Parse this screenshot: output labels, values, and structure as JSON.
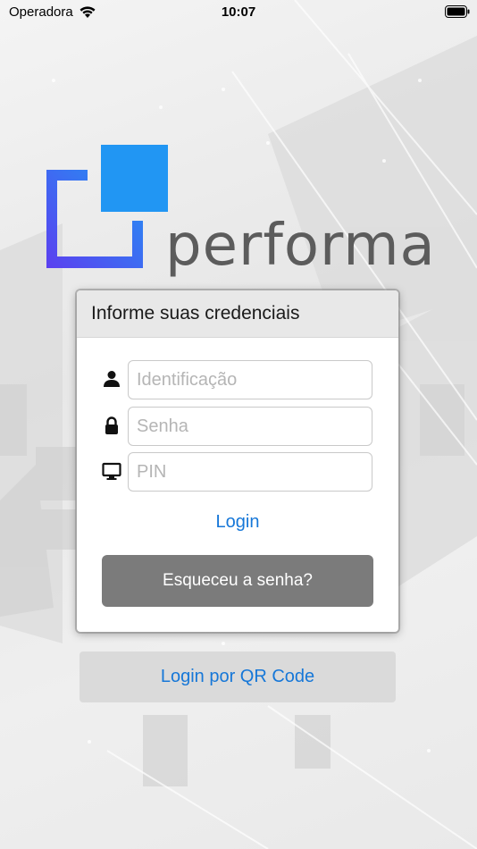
{
  "status_bar": {
    "carrier": "Operadora",
    "time": "10:07"
  },
  "brand": {
    "name": "performa",
    "colors": {
      "logo_blue": "#2196f3",
      "logo_purple": "#5b3ff0",
      "wordmark": "#5c5c5c"
    }
  },
  "login_card": {
    "title": "Informe suas credenciais",
    "fields": [
      {
        "icon": "user-icon",
        "placeholder": "Identificação",
        "value": ""
      },
      {
        "icon": "lock-icon",
        "placeholder": "Senha",
        "value": ""
      },
      {
        "icon": "monitor-icon",
        "placeholder": "PIN",
        "value": ""
      }
    ],
    "login_label": "Login",
    "forgot_label": "Esqueceu a senha?"
  },
  "qr_login_label": "Login por QR Code",
  "colors": {
    "link": "#1677d8",
    "forgot_button": "#7b7b7b",
    "qr_button": "#dadada"
  }
}
